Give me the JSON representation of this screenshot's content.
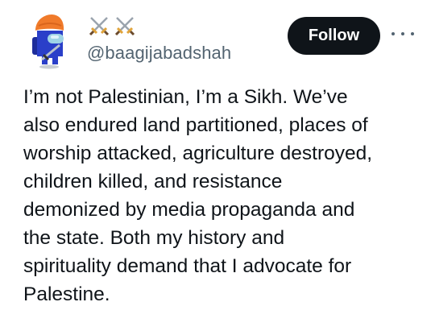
{
  "author": {
    "display_name_icons": [
      "crossed-swords-icon",
      "crossed-swords-icon"
    ],
    "handle": "@baagijabadshah",
    "avatar": "among-us-crewmate-with-orange-turban-and-sword-icon"
  },
  "actions": {
    "follow_label": "Follow",
    "more_icon": "more-options-icon"
  },
  "tweet": {
    "lines": [
      "I’m not Palestinian, I’m a Sikh. We’ve",
      "also endured land partitioned, places of",
      "worship attacked, agriculture destroyed,",
      "children killed, and resistance",
      "demonized by media propaganda and",
      "the state. Both my history and",
      "spirituality demand that I advocate for",
      "Palestine."
    ]
  },
  "colors": {
    "text": "#0f1419",
    "secondary_text": "#536471",
    "button_bg": "#0f1419",
    "button_text": "#ffffff",
    "turban": "#f07a2a",
    "crewmate_body": "#2a3fc9"
  }
}
